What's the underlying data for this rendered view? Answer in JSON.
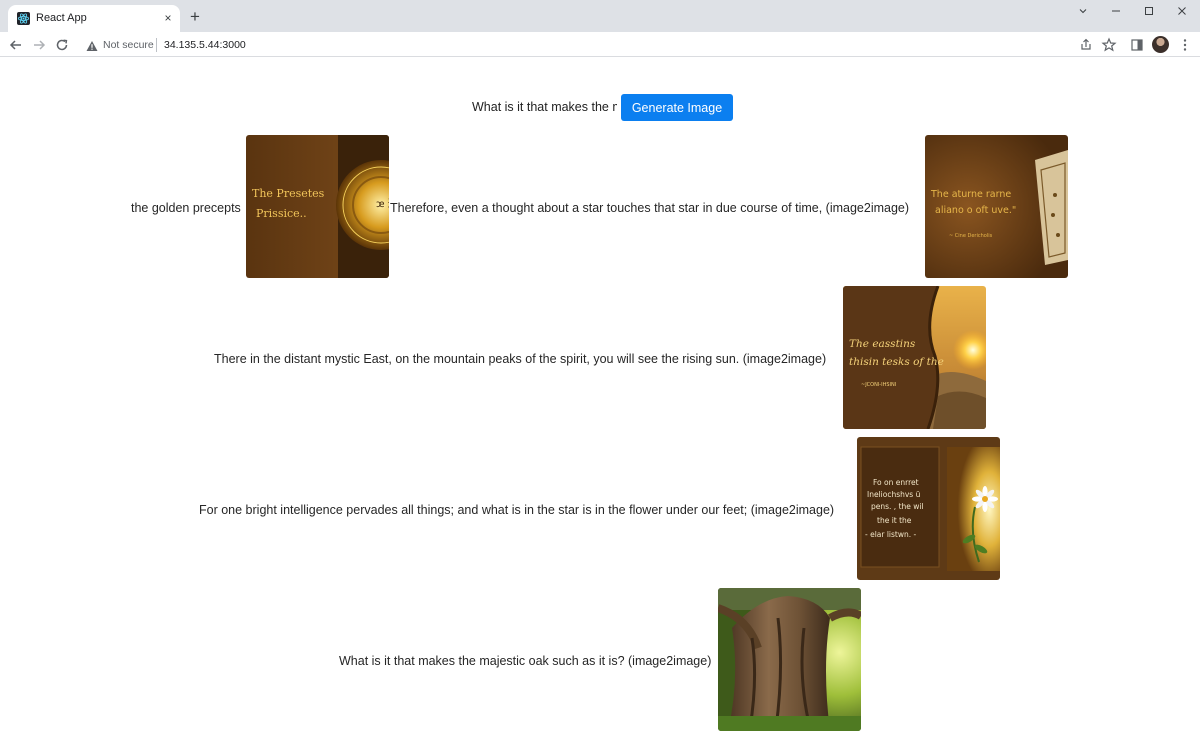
{
  "browser": {
    "tab_title": "React App",
    "tab_close": "×",
    "new_tab": "+",
    "security_label": "Not secure",
    "url": "34.135.5.44:3000"
  },
  "form": {
    "prompt_value": "What is it that makes the majestic oak such as it is?",
    "button_label": "Generate Image"
  },
  "results": [
    {
      "text": "the golden precepts",
      "image_caption_lines": [
        "The Presetes",
        "Prissice.."
      ],
      "image_glyph": "ꭢ 道"
    },
    {
      "text": "Therefore, even a thought about a star touches that star in due course of time, (image2image)",
      "image_caption_lines": [
        "The aturne rarne",
        "aliano o oft uve.\""
      ],
      "image_attribution": "~ Cine Dericholis"
    },
    {
      "text": "There in the distant mystic East, on the mountain peaks of the spirit, you will see the rising sun. (image2image)",
      "image_caption_lines": [
        "The easstins",
        "thisin tesks of the"
      ],
      "image_attribution": "~JCONI-IHSINI"
    },
    {
      "text": "For one bright intelligence pervades all things; and what is in the star is in the flower under our feet; (image2image)",
      "image_caption_lines": [
        "Fo on enrret",
        "Ineliochshvs ü",
        "pens. , the wil",
        "the it the",
        "- elar listwn. -"
      ]
    },
    {
      "text": "What is it that makes the majestic oak such as it is? (image2image)"
    }
  ],
  "colors": {
    "accent_button": "#0b7ff0",
    "tab_strip": "#dee1e6"
  },
  "icons": [
    "react-favicon-icon",
    "close-icon",
    "plus-icon",
    "back-arrow-icon",
    "forward-arrow-icon",
    "reload-icon",
    "warning-icon",
    "share-icon",
    "star-icon",
    "side-panel-icon",
    "avatar",
    "menu-dots-icon",
    "minimize-icon",
    "maximize-icon",
    "window-close-icon",
    "chevron-down-icon"
  ]
}
